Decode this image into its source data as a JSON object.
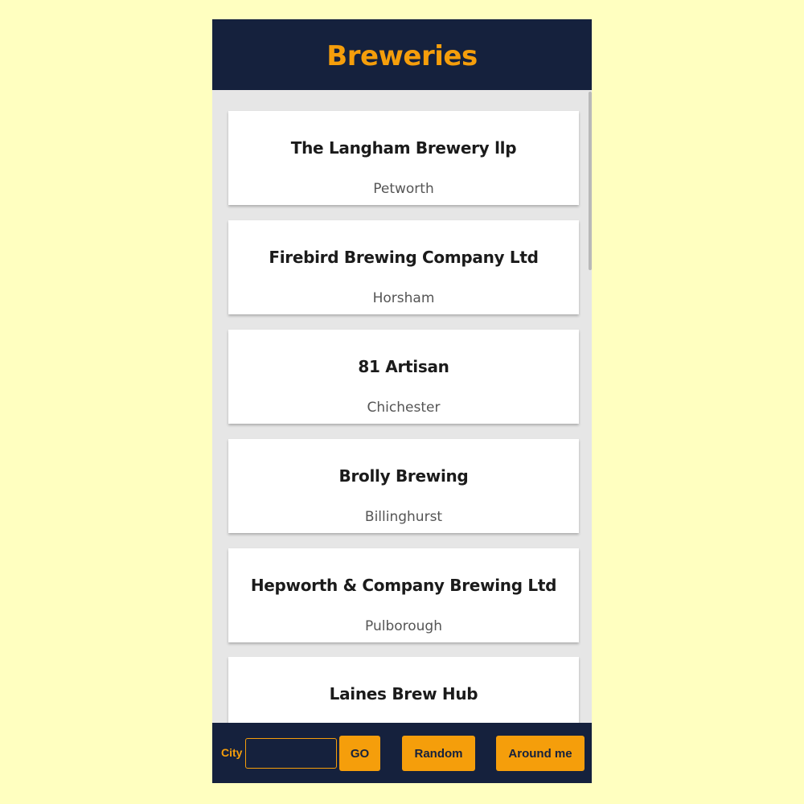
{
  "header": {
    "title": "Breweries"
  },
  "breweries": [
    {
      "name": "The Langham Brewery llp",
      "city": "Petworth"
    },
    {
      "name": "Firebird Brewing Company Ltd",
      "city": "Horsham"
    },
    {
      "name": "81 Artisan",
      "city": "Chichester"
    },
    {
      "name": "Brolly Brewing",
      "city": "Billinghurst"
    },
    {
      "name": "Hepworth & Company Brewing Ltd",
      "city": "Pulborough"
    },
    {
      "name": "Laines Brew Hub",
      "city": ""
    }
  ],
  "footer": {
    "city_label": "City",
    "city_value": "",
    "go_label": "GO",
    "random_label": "Random",
    "around_label": "Around me"
  },
  "colors": {
    "page_background": "#ffffc0",
    "navy": "#15213d",
    "accent": "#f59e0b",
    "list_background": "#e6e6e6"
  }
}
